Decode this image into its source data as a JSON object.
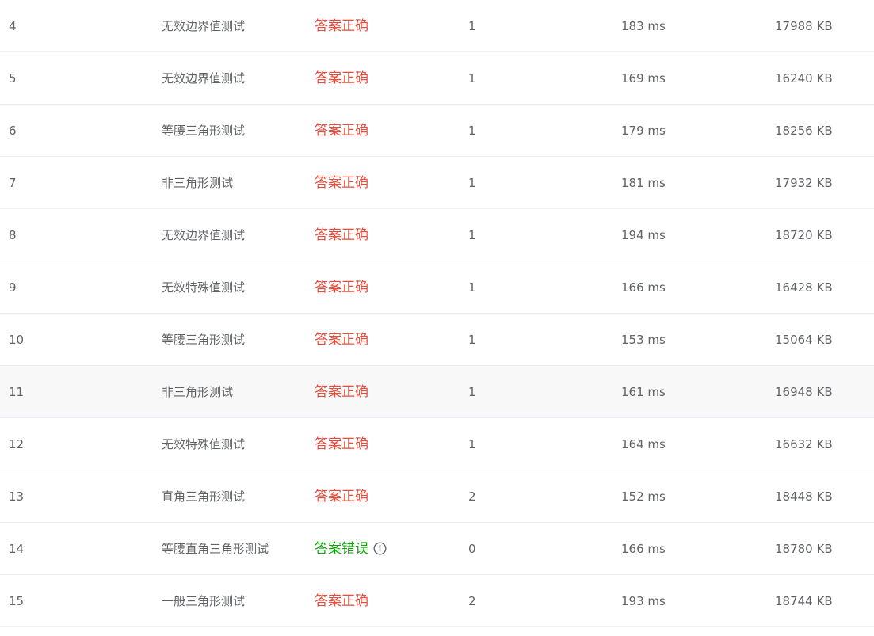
{
  "rows": [
    {
      "id": "4",
      "name": "无效边界值测试",
      "result": "答案正确",
      "status": "ok",
      "score": "1",
      "time": "183 ms",
      "memory": "17988 KB"
    },
    {
      "id": "5",
      "name": "无效边界值测试",
      "result": "答案正确",
      "status": "ok",
      "score": "1",
      "time": "169 ms",
      "memory": "16240 KB"
    },
    {
      "id": "6",
      "name": "等腰三角形测试",
      "result": "答案正确",
      "status": "ok",
      "score": "1",
      "time": "179 ms",
      "memory": "18256 KB"
    },
    {
      "id": "7",
      "name": "非三角形测试",
      "result": "答案正确",
      "status": "ok",
      "score": "1",
      "time": "181 ms",
      "memory": "17932 KB"
    },
    {
      "id": "8",
      "name": "无效边界值测试",
      "result": "答案正确",
      "status": "ok",
      "score": "1",
      "time": "194 ms",
      "memory": "18720 KB"
    },
    {
      "id": "9",
      "name": "无效特殊值测试",
      "result": "答案正确",
      "status": "ok",
      "score": "1",
      "time": "166 ms",
      "memory": "16428 KB"
    },
    {
      "id": "10",
      "name": "等腰三角形测试",
      "result": "答案正确",
      "status": "ok",
      "score": "1",
      "time": "153 ms",
      "memory": "15064 KB"
    },
    {
      "id": "11",
      "name": "非三角形测试",
      "result": "答案正确",
      "status": "ok",
      "score": "1",
      "time": "161 ms",
      "memory": "16948 KB"
    },
    {
      "id": "12",
      "name": "无效特殊值测试",
      "result": "答案正确",
      "status": "ok",
      "score": "1",
      "time": "164 ms",
      "memory": "16632 KB"
    },
    {
      "id": "13",
      "name": "直角三角形测试",
      "result": "答案正确",
      "status": "ok",
      "score": "2",
      "time": "152 ms",
      "memory": "18448 KB"
    },
    {
      "id": "14",
      "name": "等腰直角三角形测试",
      "result": "答案错误",
      "status": "err",
      "score": "0",
      "time": "166 ms",
      "memory": "18780 KB",
      "icon": "info-icon"
    },
    {
      "id": "15",
      "name": "一般三角形测试",
      "result": "答案正确",
      "status": "ok",
      "score": "2",
      "time": "193 ms",
      "memory": "18744 KB"
    }
  ],
  "colors": {
    "correct": "#e74c3c",
    "wrong": "#13a10e",
    "text": "#606266",
    "hover_row": "#f8f8f8",
    "border": "#ebeef5"
  },
  "hovered_row_id": "11"
}
